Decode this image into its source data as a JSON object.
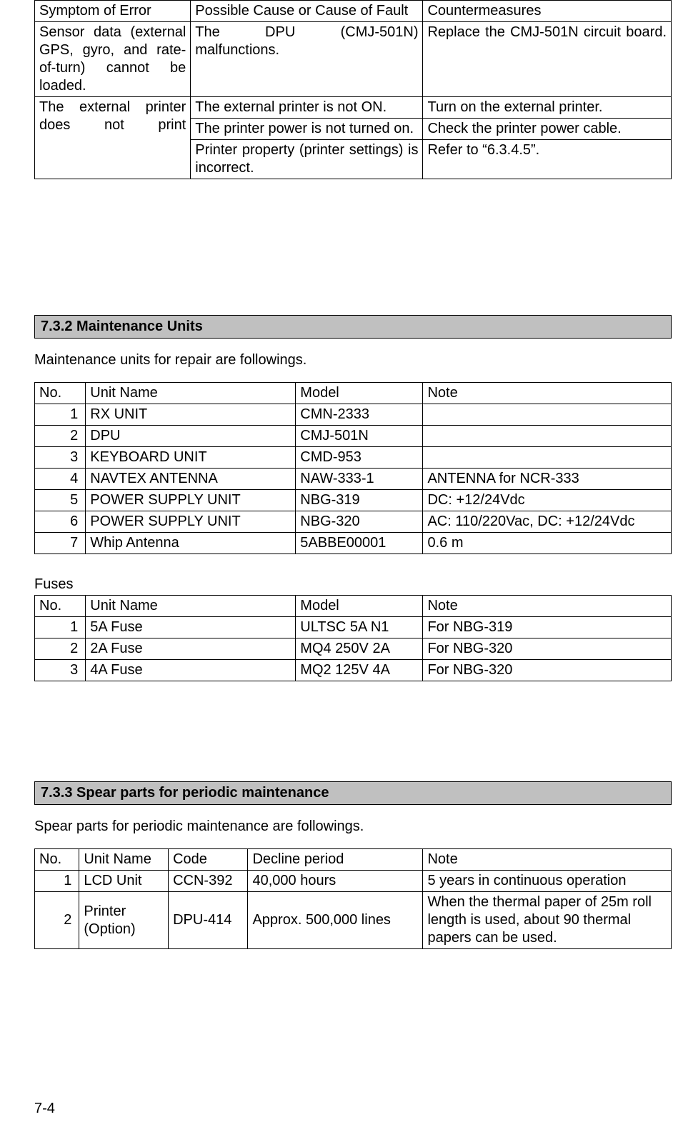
{
  "trouble": {
    "header": {
      "symptom": "Symptom of Error",
      "cause": "Possible Cause or Cause of Fault",
      "counter": "Countermeasures"
    },
    "row_sensor": {
      "symptom": "Sensor data (external GPS, gyro, and rate-of-turn) cannot be loaded.",
      "cause": "The DPU (CMJ-501N) malfunctions.",
      "counter": "Replace the CMJ-501N circuit board."
    },
    "row_printer": {
      "symptom": "The external printer does not print",
      "c1": "The external printer is not ON.",
      "m1": "Turn on the external printer.",
      "c2": "The printer power is not turned on.",
      "m2": "Check the printer power cable.",
      "c3": "Printer property (printer settings) is incorrect.",
      "m3": "Refer to “6.3.4.5”."
    }
  },
  "sec732": {
    "title": "7.3.2 Maintenance Units",
    "intro": "Maintenance units for repair are followings.",
    "header": {
      "no": "No.",
      "unit": "Unit Name",
      "model": "Model",
      "note": "Note"
    },
    "rows": [
      {
        "no": "1",
        "unit": "RX UNIT",
        "model": "CMN-2333",
        "note": ""
      },
      {
        "no": "2",
        "unit": "DPU",
        "model": "CMJ-501N",
        "note": ""
      },
      {
        "no": "3",
        "unit": "KEYBOARD UNIT",
        "model": "CMD-953",
        "note": ""
      },
      {
        "no": "4",
        "unit": "NAVTEX ANTENNA",
        "model": "NAW-333-1",
        "note": "ANTENNA for NCR-333"
      },
      {
        "no": "5",
        "unit": "POWER SUPPLY UNIT",
        "model": "NBG-319",
        "note": "DC: +12/24Vdc"
      },
      {
        "no": "6",
        "unit": "POWER SUPPLY UNIT",
        "model": "NBG-320",
        "note": "AC: 110/220Vac, DC: +12/24Vdc"
      },
      {
        "no": "7",
        "unit": "Whip Antenna",
        "model": "5ABBE00001",
        "note": "0.6 m"
      }
    ],
    "fuses_label": "Fuses",
    "fuses_header": {
      "no": "No.",
      "unit": "Unit Name",
      "model": "Model",
      "note": "Note"
    },
    "fuses": [
      {
        "no": "1",
        "unit": "5A Fuse",
        "model": "ULTSC 5A N1",
        "note": "For NBG-319"
      },
      {
        "no": "2",
        "unit": "2A Fuse",
        "model": "MQ4 250V 2A",
        "note": "For NBG-320"
      },
      {
        "no": "3",
        "unit": "4A Fuse",
        "model": "MQ2 125V 4A",
        "note": "For NBG-320"
      }
    ]
  },
  "sec733": {
    "title": "7.3.3 Spear parts for periodic maintenance",
    "intro": "Spear parts for periodic maintenance are followings.",
    "header": {
      "no": "No.",
      "unit": "Unit Name",
      "code": "Code",
      "decline": "Decline period",
      "note": "Note"
    },
    "rows": [
      {
        "no": "1",
        "unit": "LCD Unit",
        "code": "CCN-392",
        "decline": "40,000 hours",
        "note": "5 years in continuous operation"
      },
      {
        "no": "2",
        "unit": "Printer (Option)",
        "code": "DPU-414",
        "decline": "Approx. 500,000 lines",
        "note": "When the thermal paper of 25m roll length is used, about 90 thermal papers can be used."
      }
    ]
  },
  "pageno": "7-4"
}
